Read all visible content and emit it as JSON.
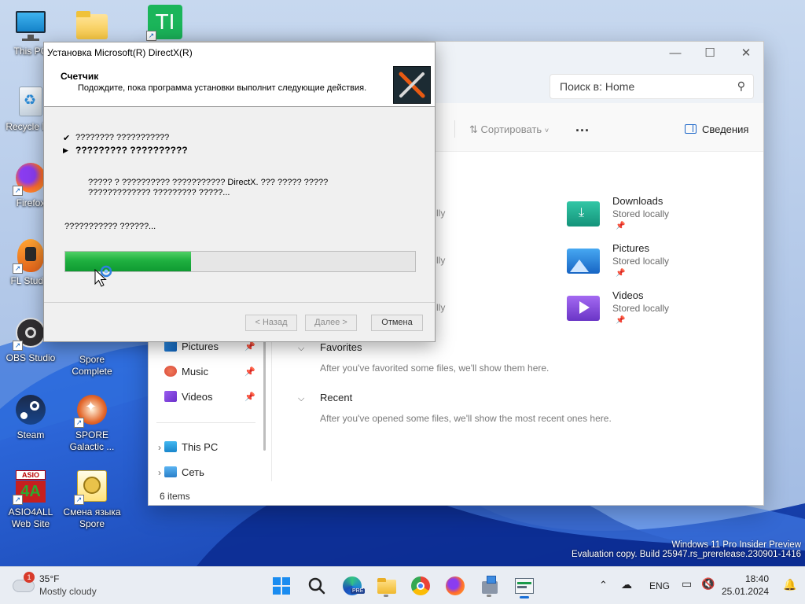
{
  "desktop": {
    "icons": [
      {
        "label": "This PC"
      },
      {
        "label": "Recycle Bin"
      },
      {
        "label": "Firefox"
      },
      {
        "label": "FL Studio"
      },
      {
        "label": "OBS Studio"
      },
      {
        "label": "Steam"
      },
      {
        "label": "ASIO4ALL Web Site"
      },
      {
        "label": "Spore Complete"
      },
      {
        "label": "SPORE Galactic ..."
      },
      {
        "label": "Смена языка Spore"
      },
      {
        "label": "TI"
      }
    ],
    "watermark_line1": "Windows 11 Pro Insider Preview",
    "watermark_line2": "Evaluation copy. Build 25947.rs_prerelease.230901-1416"
  },
  "explorer": {
    "search_placeholder": "Поиск в: Home",
    "sort_label": "Сортировать",
    "more_label": "...",
    "details_label": "Сведения",
    "nav": [
      {
        "label": "Pictures",
        "icon": "pictures-icon"
      },
      {
        "label": "Music",
        "icon": "music-icon"
      },
      {
        "label": "Videos",
        "icon": "videos-icon"
      },
      {
        "label": "This PC",
        "icon": "this-pc-icon"
      },
      {
        "label": "Сеть",
        "icon": "network-icon"
      }
    ],
    "quick_access": [
      {
        "name": "Downloads",
        "sub": "Stored locally"
      },
      {
        "name": "Pictures",
        "sub": "Stored locally"
      },
      {
        "name": "Videos",
        "sub": "Stored locally"
      }
    ],
    "partial_sub": "lly",
    "favorites_title": "Favorites",
    "favorites_body": "After you've favorited some files, we'll show them here.",
    "recent_title": "Recent",
    "recent_body": "After you've opened some files, we'll show the most recent ones here.",
    "status": "6 items"
  },
  "dialog": {
    "title": "Установка Microsoft(R) DirectX(R)",
    "header_title": "Счетчик",
    "header_sub": "Подождите, пока программа установки выполнит следующие действия.",
    "step1": "???????? ???????????",
    "step2": "????????? ??????????",
    "desc_line1": "????? ? ?????????? ??????????? DirectX. ??? ????? ?????",
    "desc_line2": "????????????? ????????? ?????...",
    "status_text": "??????????? ??????...",
    "progress": 0.36,
    "btn_back": "< Назад",
    "btn_next": "Далее >",
    "btn_cancel": "Отмена"
  },
  "taskbar": {
    "weather_temp": "35°F",
    "weather_cond": "Mostly cloudy",
    "weather_badge": "1",
    "lang": "ENG",
    "time": "18:40",
    "date": "25.01.2024"
  },
  "colors": {
    "progress_green": "#1fb040",
    "explorer_accent": "#1c66c8",
    "wallpaper_blue": "#1a5cd6"
  }
}
